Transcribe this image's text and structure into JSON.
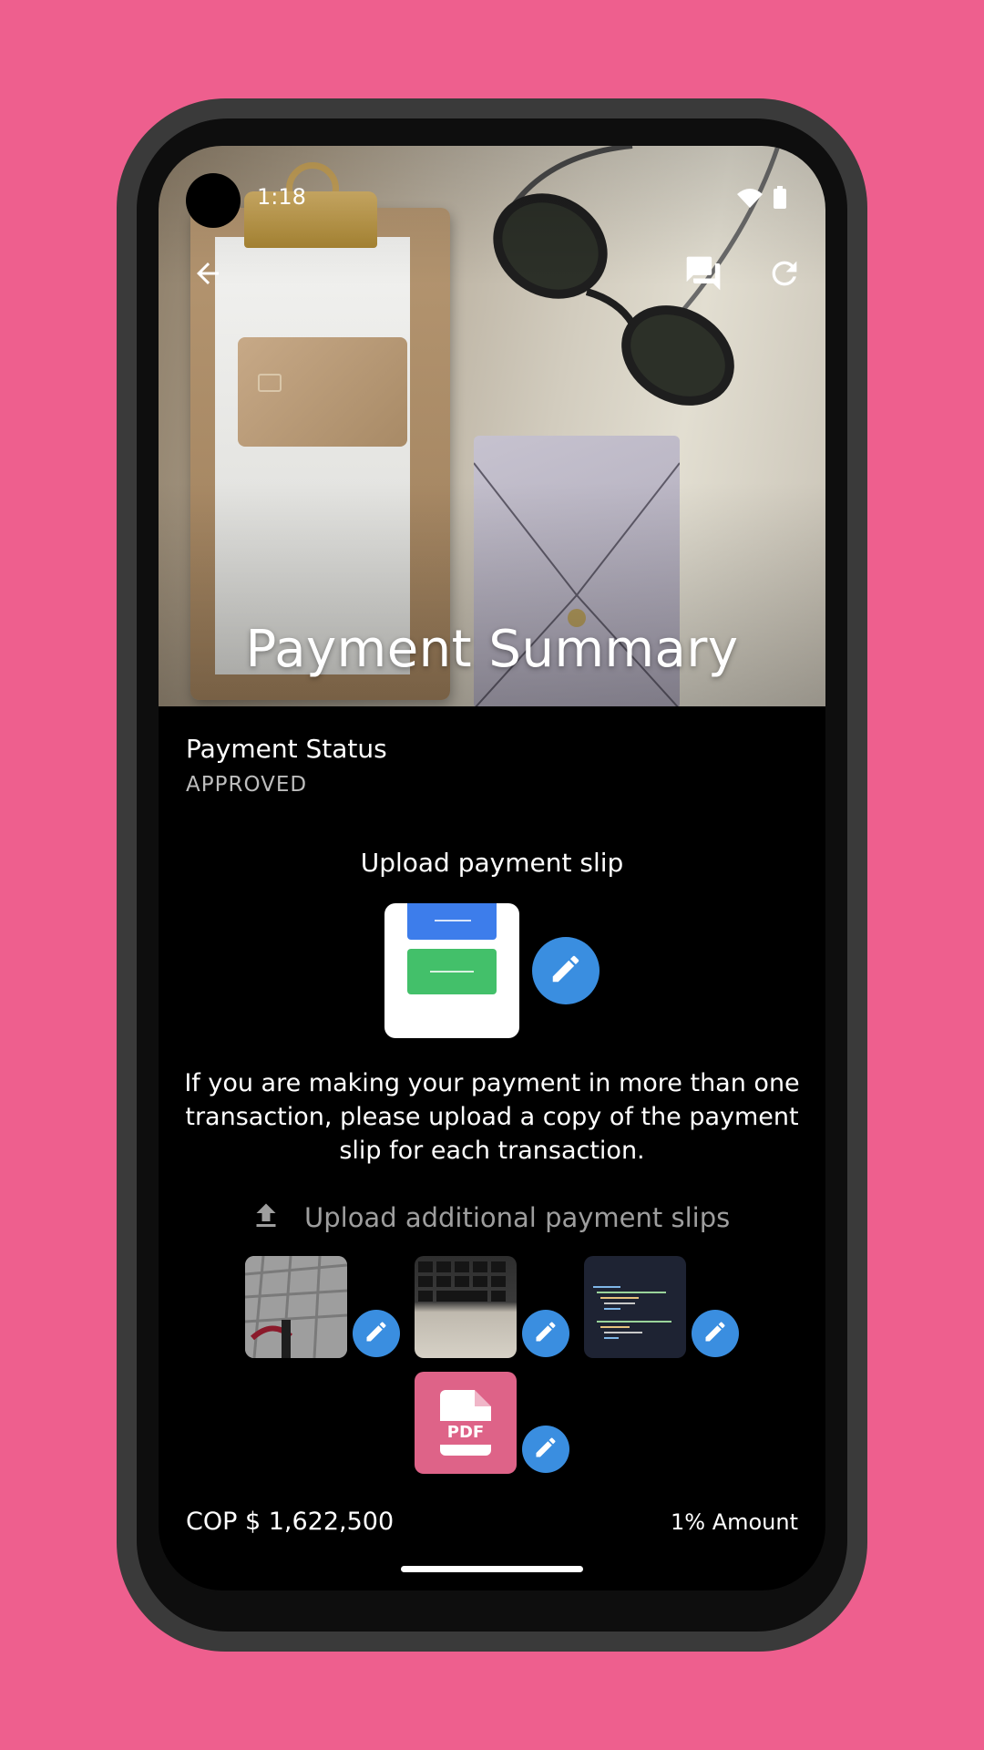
{
  "status_bar": {
    "time": "1:18"
  },
  "header": {
    "title": "Payment Summary",
    "back_icon": "arrow-left-icon",
    "chat_icon": "forum-icon",
    "refresh_icon": "refresh-icon"
  },
  "payment_status": {
    "label": "Payment Status",
    "value": "APPROVED"
  },
  "upload": {
    "title": "Upload payment slip",
    "info": "If you are making your payment in more than one transaction, please upload a copy of the payment slip for each transaction.",
    "additional_label": "Upload additional payment slips",
    "pdf_label": "PDF"
  },
  "footer": {
    "amount": "COP $ 1,622,500",
    "percent": "1% Amount"
  },
  "colors": {
    "background": "#EE5F8E",
    "accent": "#3A8EE0",
    "pdf_tile": "#DE6388"
  }
}
